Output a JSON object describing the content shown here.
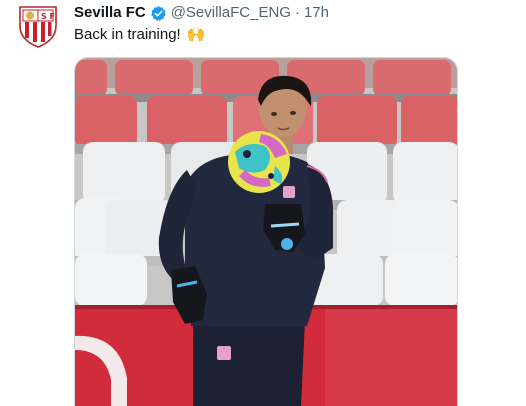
{
  "tweet": {
    "display_name": "Sevilla FC",
    "handle": "@SevillaFC_ENG",
    "separator": "·",
    "time": "17h",
    "text": "Back in training!",
    "emoji": "🙌"
  },
  "icons": {
    "avatar": "sevilla-crest-icon",
    "verified": "verified-badge-icon"
  },
  "colors": {
    "verified_blue": "#1d9bf0",
    "handle_gray": "#536471",
    "name_black": "#0f1419",
    "seat_red": "#d9646a",
    "seat_white": "#eceeef",
    "board_red": "#d62a3a"
  }
}
